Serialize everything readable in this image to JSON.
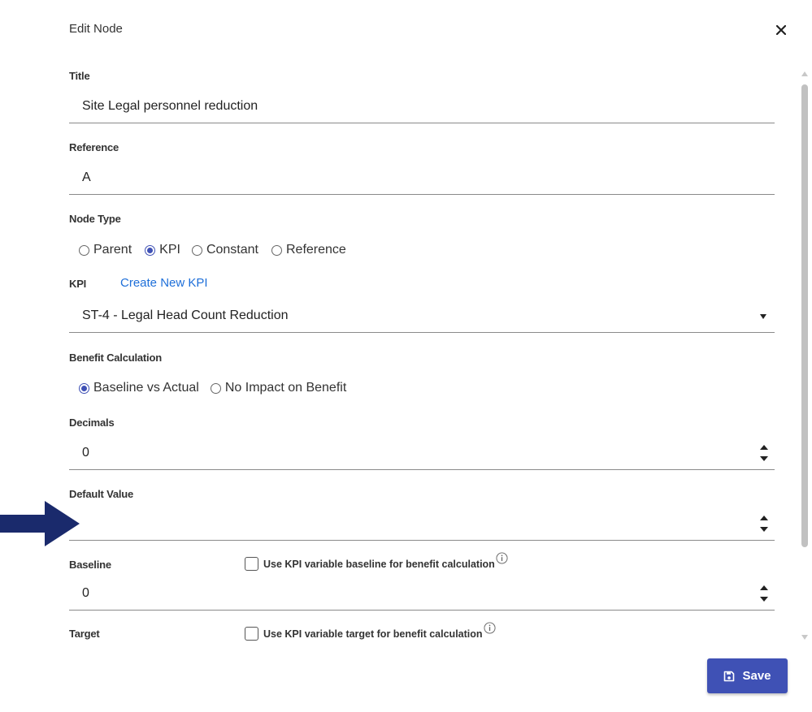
{
  "dialog": {
    "title": "Edit Node",
    "close_icon": "close-icon"
  },
  "title_field": {
    "label": "Title",
    "value": "Site Legal personnel reduction"
  },
  "reference_field": {
    "label": "Reference",
    "value": "A"
  },
  "node_type": {
    "label": "Node Type",
    "options": [
      "Parent",
      "KPI",
      "Constant",
      "Reference"
    ],
    "selected": "KPI"
  },
  "kpi": {
    "label": "KPI",
    "create_link": "Create New KPI",
    "selected": "ST-4 - Legal Head Count Reduction"
  },
  "benefit_calculation": {
    "label": "Benefit Calculation",
    "options": [
      "Baseline vs Actual",
      "No Impact on Benefit"
    ],
    "selected": "Baseline vs Actual"
  },
  "decimals": {
    "label": "Decimals",
    "value": "0"
  },
  "default_value": {
    "label": "Default Value",
    "value": ""
  },
  "baseline": {
    "label": "Baseline",
    "checkbox_label": "Use KPI variable baseline for benefit calculation",
    "checked": false,
    "value": "0"
  },
  "target": {
    "label": "Target",
    "checkbox_label": "Use KPI variable target for benefit calculation",
    "checked": false
  },
  "footer": {
    "save_label": "Save",
    "save_icon": "floppy-disk-icon"
  },
  "colors": {
    "accent": "#3f51b5",
    "link": "#1e6fd9",
    "annotation_arrow": "#1a2a6c"
  }
}
